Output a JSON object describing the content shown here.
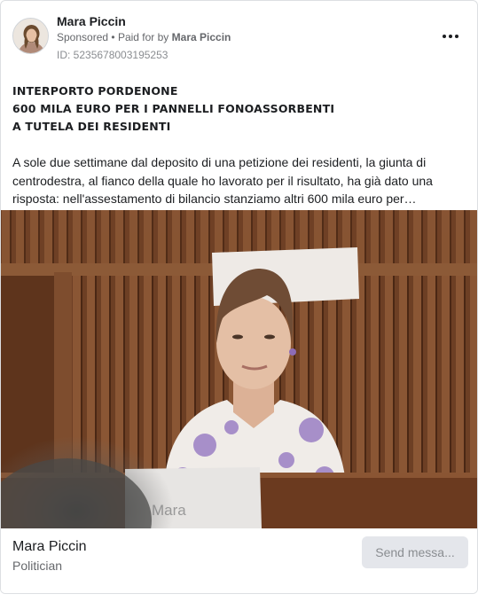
{
  "header": {
    "page_name": "Mara Piccin",
    "sponsored_label": "Sponsored",
    "paid_for_prefix": "Paid for by",
    "paid_for_name": "Mara Piccin",
    "ad_id": "ID: 5235678003195253",
    "more_icon": "more-horizontal-icon"
  },
  "ad": {
    "headline_lines": [
      "INTERPORTO PORDENONE",
      "600 MILA EURO PER I PANNELLI FONOASSORBENTI",
      "A TUTELA DEI RESIDENTI"
    ],
    "body": "A sole due settimane dal deposito di una petizione dei residenti, la giunta di centrodestra, al fianco della quale ho lavorato per il risultato, ha già dato una risposta: nell'assestamento di bilancio stanziamo altri 600 mila euro per…"
  },
  "media": {
    "nameplate_text": "Mara"
  },
  "footer": {
    "name": "Mara Piccin",
    "category": "Politician",
    "cta_label": "Send messa..."
  },
  "colors": {
    "text_primary": "#1c1e21",
    "text_secondary": "#65676b",
    "button_bg": "#e4e6eb"
  }
}
